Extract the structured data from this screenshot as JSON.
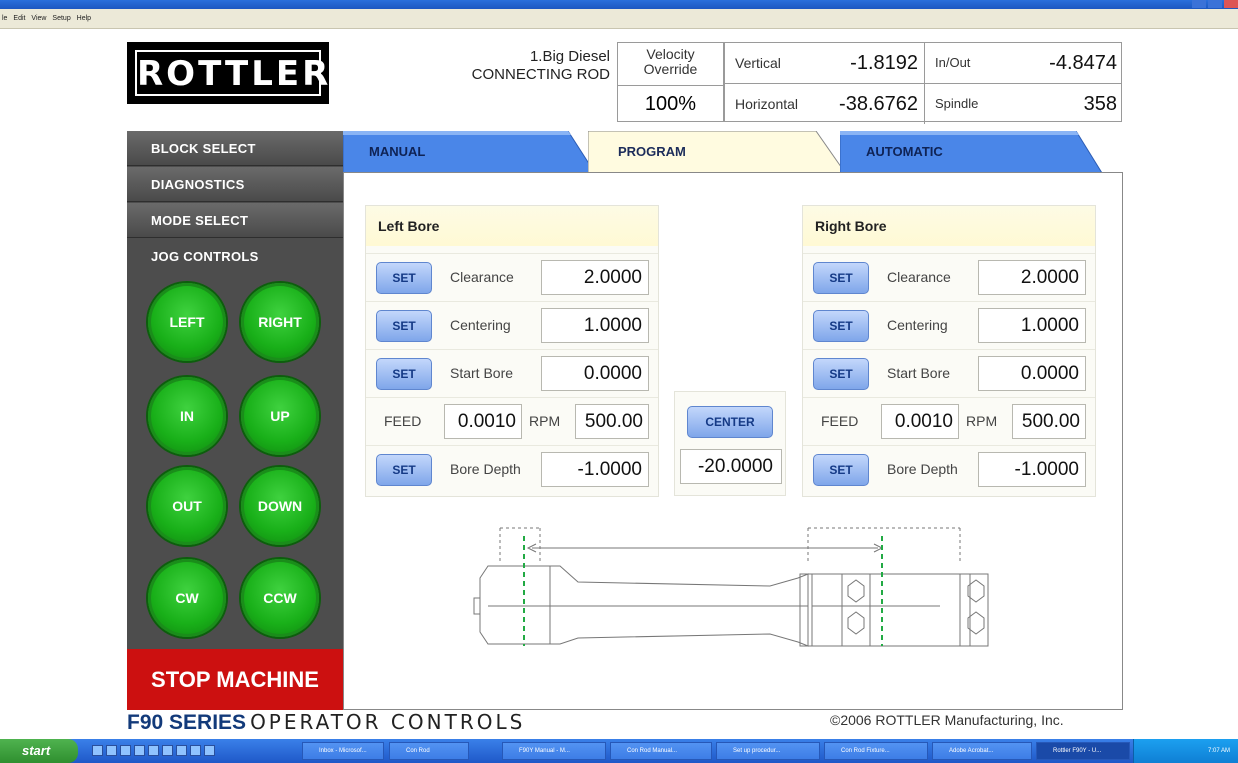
{
  "menubar": {
    "items": [
      "le",
      "Edit",
      "View",
      "Setup",
      "Help"
    ]
  },
  "header": {
    "logo": "ROTTLER",
    "job_line1": "1.Big Diesel",
    "job_line2": "CONNECTING ROD",
    "velocity_label_1": "Velocity",
    "velocity_label_2": "Override",
    "velocity_value": "100%",
    "vertical_label": "Vertical",
    "vertical_value": "-1.8192",
    "inout_label": "In/Out",
    "inout_value": "-4.8474",
    "horizontal_label": "Horizontal",
    "horizontal_value": "-38.6762",
    "spindle_label": "Spindle",
    "spindle_value": "358"
  },
  "sidebar": {
    "items": [
      "BLOCK SELECT",
      "DIAGNOSTICS",
      "MODE SELECT",
      "JOG CONTROLS"
    ],
    "jog": [
      "LEFT",
      "RIGHT",
      "IN",
      "UP",
      "OUT",
      "DOWN",
      "CW",
      "CCW"
    ],
    "stop": "STOP MACHINE"
  },
  "tabs": {
    "manual": "MANUAL",
    "program": "PROGRAM",
    "automatic": "AUTOMATIC",
    "active": "PROGRAM"
  },
  "left_bore": {
    "title": "Left Bore",
    "set": "SET",
    "clearance_label": "Clearance",
    "clearance": "2.0000",
    "centering_label": "Centering",
    "centering": "1.0000",
    "start_label": "Start Bore",
    "start": "0.0000",
    "feed_label": "FEED",
    "feed": "0.0010",
    "rpm_label": "RPM",
    "rpm": "500.00",
    "depth_label": "Bore Depth",
    "depth": "-1.0000"
  },
  "right_bore": {
    "title": "Right Bore",
    "set": "SET",
    "clearance_label": "Clearance",
    "clearance": "2.0000",
    "centering_label": "Centering",
    "centering": "1.0000",
    "start_label": "Start Bore",
    "start": "0.0000",
    "feed_label": "FEED",
    "feed": "0.0010",
    "rpm_label": "RPM",
    "rpm": "500.00",
    "depth_label": "Bore Depth",
    "depth": "-1.0000"
  },
  "center": {
    "label": "CENTER",
    "value": "-20.0000"
  },
  "footer": {
    "brand": "F90 SERIES",
    "brand_sub": "OPERATOR CONTROLS",
    "copyright": "©2006 ROTTLER Manufacturing, Inc."
  },
  "taskbar": {
    "start": "start",
    "items": [
      "Inbox - Microsof...",
      "Con Rod",
      "F90Y Manual - M...",
      "Con Rod Manual...",
      "Set up procedur...",
      "Con Rod Fixture...",
      "Adobe Acrobat...",
      "Rottler F90Y - U..."
    ],
    "clock": "7:07 AM"
  },
  "colors": {
    "accent_blue": "#4a86e8",
    "jog_green": "#19b019",
    "stop_red": "#cc1010",
    "panel_gray": "#4d4d4d",
    "tab_active": "#fffbe0"
  }
}
